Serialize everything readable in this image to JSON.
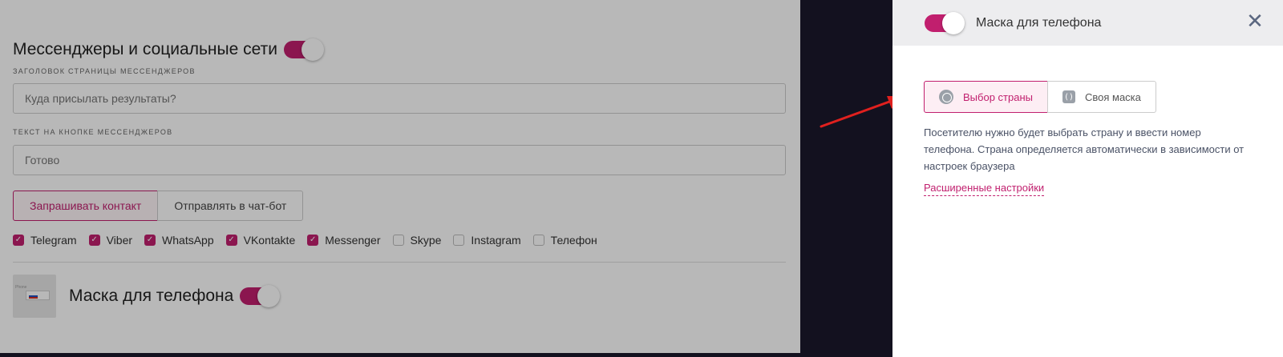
{
  "left_form": {
    "section_title": "Мессенджеры и социальные сети",
    "section_toggle_on": true,
    "header_label": "ЗАГОЛОВОК СТРАНИЦЫ МЕССЕНДЖЕРОВ",
    "header_placeholder": "Куда присылать результаты?",
    "button_label": "ТЕКСТ НА КНОПКЕ МЕССЕНДЖЕРОВ",
    "button_value": "Готово",
    "mode_options": [
      "Запрашивать контакт",
      "Отправлять в чат-бот"
    ],
    "mode_selected": "Запрашивать контакт",
    "messengers": [
      {
        "name": "Telegram",
        "checked": true
      },
      {
        "name": "Viber",
        "checked": true
      },
      {
        "name": "WhatsApp",
        "checked": true
      },
      {
        "name": "VKontakte",
        "checked": true
      },
      {
        "name": "Messenger",
        "checked": true
      },
      {
        "name": "Skype",
        "checked": false
      },
      {
        "name": "Instagram",
        "checked": false
      },
      {
        "name": "Телефон",
        "checked": false
      }
    ],
    "mask_title": "Маска для телефона",
    "mask_toggle_on": true,
    "thumb_text": "Phone"
  },
  "right_panel": {
    "title": "Маска для телефона",
    "toggle_on": true,
    "close_icon": "close-icon",
    "options": [
      {
        "label": "Выбор страны",
        "icon": "globe-icon",
        "active": true
      },
      {
        "label": "Своя маска",
        "icon": "bracket-icon",
        "active": false
      }
    ],
    "description": "Посетителю нужно будет выбрать страну и ввести номер телефона. Страна определяется автоматически в зависимости от настроек браузера",
    "advanced_link": "Расширенные настройки"
  },
  "colors": {
    "accent": "#c11f6e",
    "background_dark": "#13111f",
    "header_bg": "#ededef",
    "arrow": "#e0201e"
  }
}
